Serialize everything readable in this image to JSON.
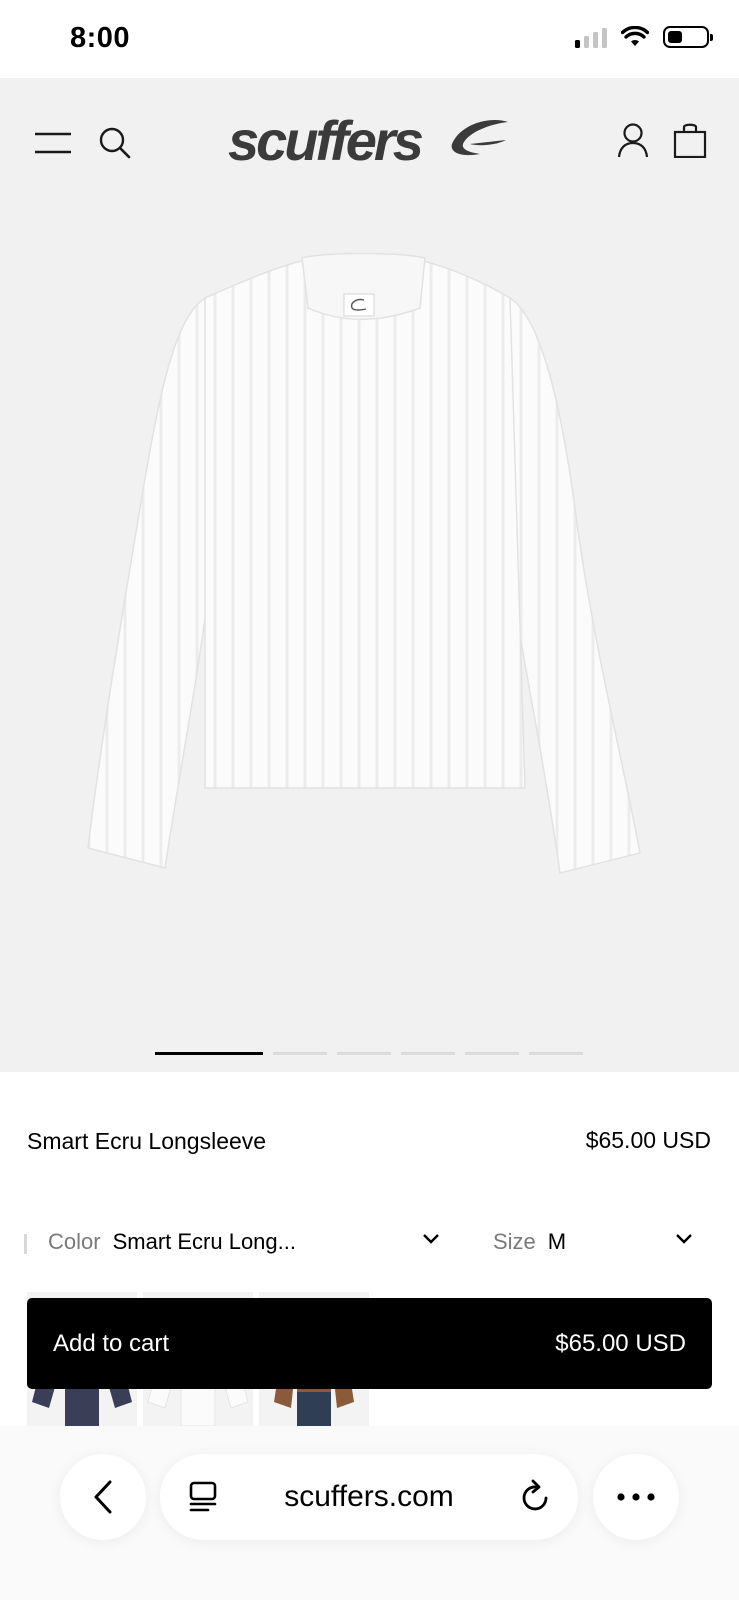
{
  "status_bar": {
    "time": "8:00",
    "icons": [
      "cellular-signal-icon",
      "wifi-icon",
      "battery-icon"
    ]
  },
  "header": {
    "logo_text": "scuffers",
    "icons": [
      "menu-icon",
      "search-icon",
      "account-icon",
      "cart-icon"
    ]
  },
  "carousel": {
    "total_slides": 6,
    "active_index": 0
  },
  "product": {
    "title": "Smart Ecru Longsleeve",
    "price": "$65.00 USD"
  },
  "options": {
    "color_label": "Color",
    "color_value": "Smart Ecru Long...",
    "size_label": "Size",
    "size_value": "M"
  },
  "cart_button": {
    "label": "Add to cart",
    "price": "$65.00 USD"
  },
  "browser": {
    "url": "scuffers.com",
    "icons": [
      "back-icon",
      "tabs-icon",
      "reload-icon",
      "more-icon"
    ]
  },
  "colors": {
    "hero_bg": "#f1f1f1",
    "button_bg": "#000000",
    "logo": "#3b3b3b",
    "muted_label": "#7a7a7a"
  }
}
